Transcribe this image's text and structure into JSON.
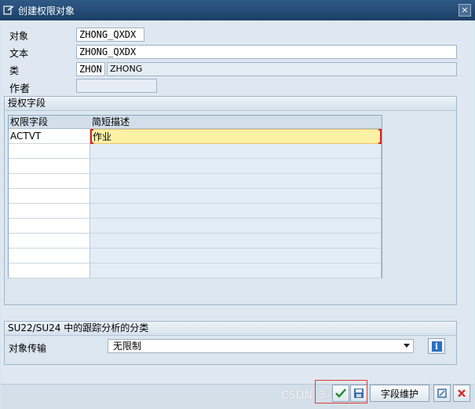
{
  "window": {
    "title": "创建权限对象",
    "close_glyph": "×"
  },
  "header_fields": {
    "object_label": "对象",
    "object_value": "ZHONG_QXDX",
    "text_label": "文本",
    "text_value": "ZHONG_QXDX",
    "class_label": "类",
    "class_code": "ZHON",
    "class_desc": "ZHONG",
    "author_label": "作者",
    "author_value": ""
  },
  "auth_fields": {
    "title": "授权字段",
    "columns": [
      "权限字段",
      "简短描述"
    ],
    "rows": [
      {
        "field": "ACTVT",
        "desc": "作业"
      },
      {
        "field": "",
        "desc": ""
      },
      {
        "field": "",
        "desc": ""
      },
      {
        "field": "",
        "desc": ""
      },
      {
        "field": "",
        "desc": ""
      },
      {
        "field": "",
        "desc": ""
      },
      {
        "field": "",
        "desc": ""
      },
      {
        "field": "",
        "desc": ""
      },
      {
        "field": "",
        "desc": ""
      },
      {
        "field": "",
        "desc": ""
      }
    ]
  },
  "trace": {
    "title": "SU22/SU24 中的跟踪分析的分类",
    "transport_label": "对象传输",
    "transport_value": "无限制"
  },
  "footer": {
    "buttons": [
      {
        "name": "confirm-button",
        "icon": "check-icon"
      },
      {
        "name": "save-button",
        "icon": "floppy-icon"
      },
      {
        "name": "field-maintenance-button",
        "label": "字段维护"
      },
      {
        "name": "other-button",
        "icon": "tools-icon"
      },
      {
        "name": "cancel-button",
        "icon": "cancel-icon"
      }
    ],
    "watermark": "CSDN @小强学IT"
  },
  "colors": {
    "title_bar": "#1c3f66",
    "active_cell": "#fdf1a6",
    "highlight": "#e23a3a"
  }
}
